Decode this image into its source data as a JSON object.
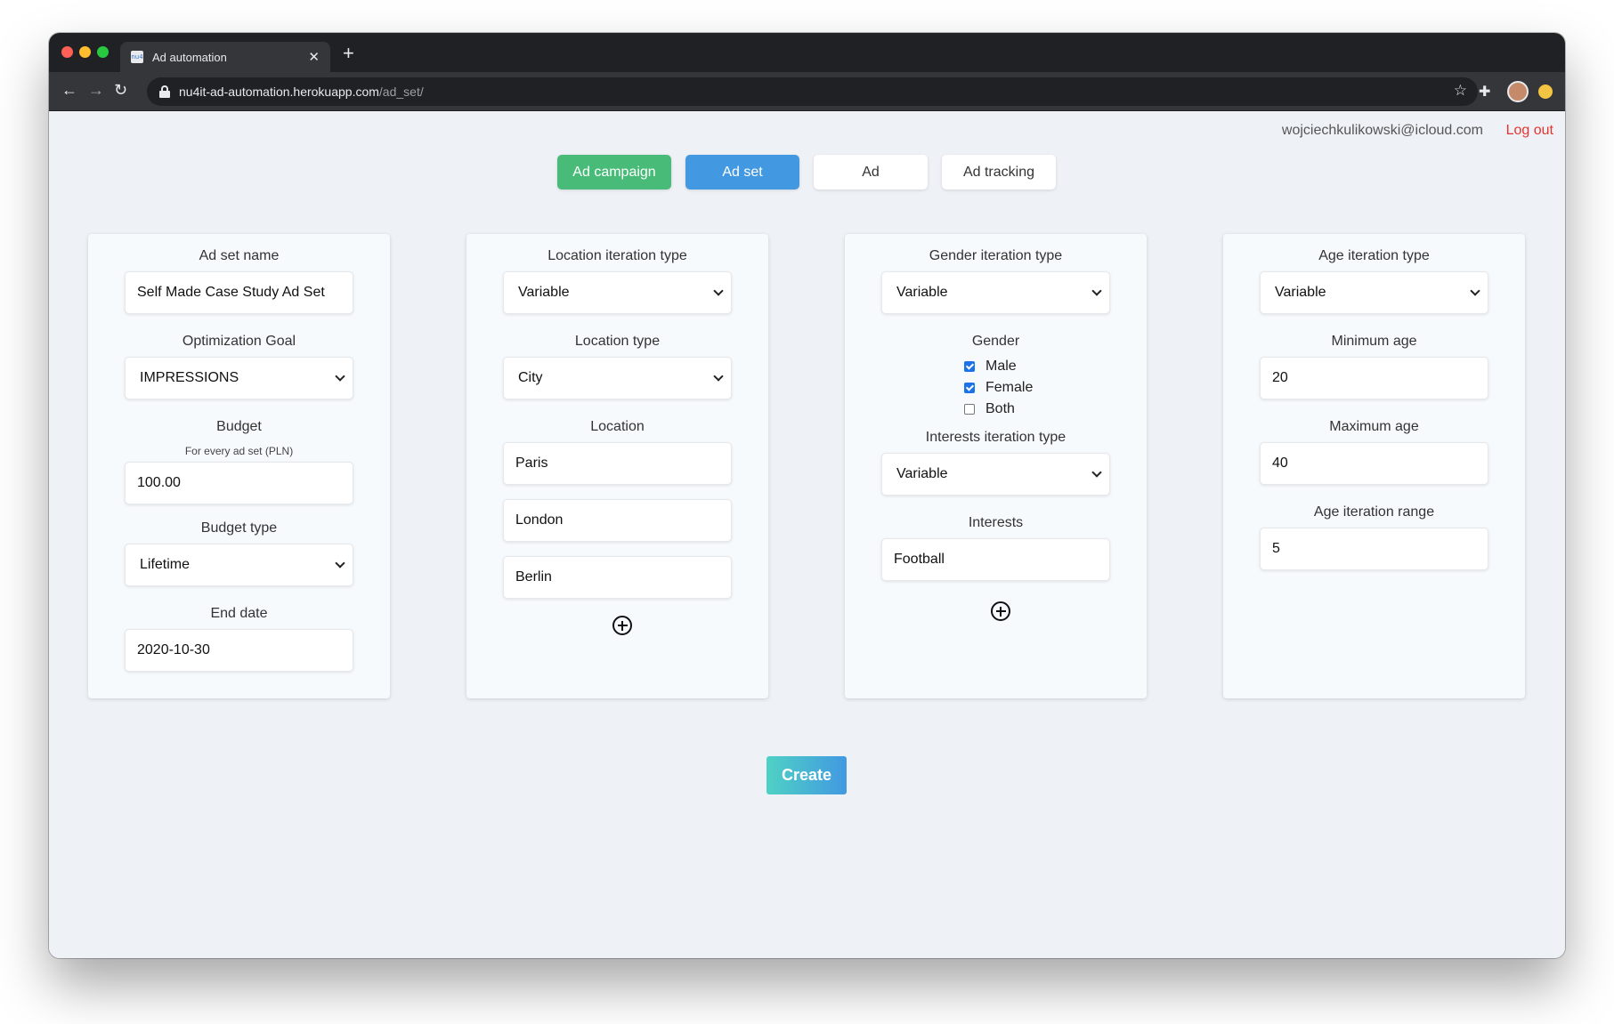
{
  "browser": {
    "tab_title": "Ad automation",
    "tab_favicon": "nu4",
    "url_host": "nu4it-ad-automation.herokuapp.com",
    "url_path": "/ad_set/"
  },
  "header": {
    "user_email": "wojciechkulikowski@icloud.com",
    "logout_label": "Log out"
  },
  "nav": {
    "tabs": [
      {
        "label": "Ad campaign"
      },
      {
        "label": "Ad set"
      },
      {
        "label": "Ad"
      },
      {
        "label": "Ad tracking"
      }
    ]
  },
  "card1": {
    "name_label": "Ad set name",
    "name_value": "Self Made Case Study Ad Set",
    "goal_label": "Optimization Goal",
    "goal_value": "IMPRESSIONS",
    "budget_label": "Budget",
    "budget_hint": "For every ad set (PLN)",
    "budget_value": "100.00",
    "budget_type_label": "Budget type",
    "budget_type_value": "Lifetime",
    "end_date_label": "End date",
    "end_date_value": "2020-10-30"
  },
  "card2": {
    "iteration_label": "Location iteration type",
    "iteration_value": "Variable",
    "type_label": "Location type",
    "type_value": "City",
    "location_label": "Location",
    "locations": [
      "Paris",
      "London",
      "Berlin"
    ]
  },
  "card3": {
    "iteration_label": "Gender iteration type",
    "iteration_value": "Variable",
    "gender_label": "Gender",
    "genders": [
      {
        "label": "Male",
        "checked": true
      },
      {
        "label": "Female",
        "checked": true
      },
      {
        "label": "Both",
        "checked": false
      }
    ],
    "interests_iteration_label": "Interests iteration type",
    "interests_iteration_value": "Variable",
    "interests_label": "Interests",
    "interests": [
      "Football"
    ]
  },
  "card4": {
    "iteration_label": "Age iteration type",
    "iteration_value": "Variable",
    "min_label": "Minimum age",
    "min_value": "20",
    "max_label": "Maximum age",
    "max_value": "40",
    "range_label": "Age iteration range",
    "range_value": "5"
  },
  "actions": {
    "create_label": "Create"
  },
  "colors": {
    "campaign_tab": "#48bb78",
    "active_tab": "#4299e1",
    "logout": "#e3342f",
    "checkbox": "#1a73e8"
  }
}
